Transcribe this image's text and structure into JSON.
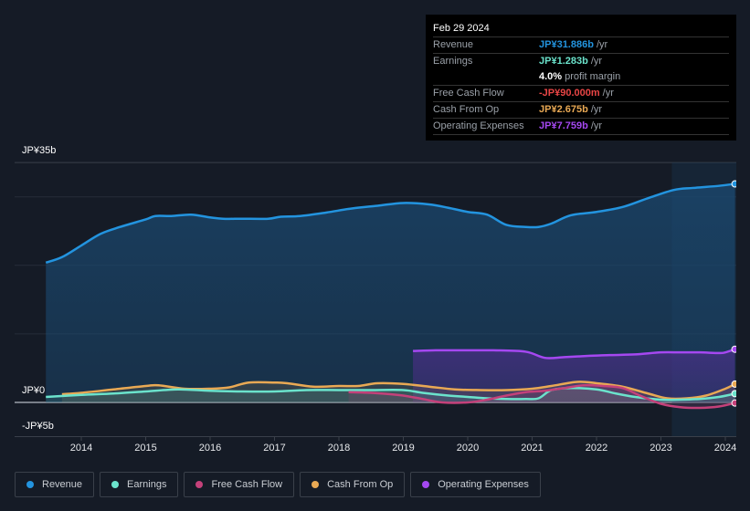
{
  "tooltip": {
    "date": "Feb 29 2024",
    "rows": [
      {
        "label": "Revenue",
        "value": "JP¥31.886b",
        "unit": "/yr",
        "color": "#2394df"
      },
      {
        "label": "Earnings",
        "value": "JP¥1.283b",
        "unit": "/yr",
        "color": "#6be3cc"
      },
      {
        "label": "",
        "value": "4.0%",
        "unit": "profit margin",
        "color": "#ffffff"
      },
      {
        "label": "Free Cash Flow",
        "value": "-JP¥90.000m",
        "unit": "/yr",
        "color": "#e84545"
      },
      {
        "label": "Cash From Op",
        "value": "JP¥2.675b",
        "unit": "/yr",
        "color": "#e9a954"
      },
      {
        "label": "Operating Expenses",
        "value": "JP¥7.759b",
        "unit": "/yr",
        "color": "#a548f1"
      }
    ]
  },
  "legend": [
    {
      "label": "Revenue",
      "color": "#2394df"
    },
    {
      "label": "Earnings",
      "color": "#6be3cc"
    },
    {
      "label": "Free Cash Flow",
      "color": "#c4417a"
    },
    {
      "label": "Cash From Op",
      "color": "#e9a954"
    },
    {
      "label": "Operating Expenses",
      "color": "#a548f1"
    }
  ],
  "chart_data": {
    "type": "line",
    "title": "",
    "xlabel": "",
    "ylabel": "",
    "y_tick_labels": [
      "JP¥35b",
      "JP¥0",
      "-JP¥5b"
    ],
    "y_ticks": [
      35,
      0,
      -5
    ],
    "ylim": [
      -5,
      35
    ],
    "xlim": [
      2013.1,
      2024.2
    ],
    "x_tick_labels": [
      "2014",
      "2015",
      "2016",
      "2017",
      "2018",
      "2019",
      "2020",
      "2021",
      "2022",
      "2023",
      "2024"
    ],
    "x_ticks": [
      2014,
      2015,
      2016,
      2017,
      2018,
      2019,
      2020,
      2021,
      2022,
      2023,
      2024
    ],
    "grid": true,
    "highlight_start": 2023.17,
    "series": [
      {
        "name": "Revenue",
        "color": "#2394df",
        "fill": true,
        "x": [
          2013.45,
          2013.7,
          2014.0,
          2014.3,
          2014.6,
          2015.0,
          2015.15,
          2015.4,
          2015.7,
          2016.0,
          2016.2,
          2016.5,
          2016.9,
          2017.1,
          2017.4,
          2017.8,
          2018.2,
          2018.6,
          2019.0,
          2019.4,
          2019.7,
          2020.0,
          2020.3,
          2020.6,
          2020.9,
          2021.1,
          2021.3,
          2021.6,
          2022.0,
          2022.4,
          2022.8,
          2023.2,
          2023.5,
          2023.9,
          2024.15
        ],
        "y": [
          20.4,
          21.2,
          22.9,
          24.6,
          25.6,
          26.7,
          27.2,
          27.2,
          27.4,
          27.0,
          26.8,
          26.8,
          26.8,
          27.1,
          27.2,
          27.7,
          28.3,
          28.7,
          29.1,
          28.9,
          28.4,
          27.8,
          27.4,
          25.9,
          25.6,
          25.6,
          26.1,
          27.3,
          27.8,
          28.5,
          29.8,
          31.0,
          31.3,
          31.6,
          31.886
        ]
      },
      {
        "name": "Earnings",
        "color": "#6be3cc",
        "fill": true,
        "x": [
          2013.45,
          2014.0,
          2014.5,
          2015.0,
          2015.5,
          2016.0,
          2016.5,
          2017.0,
          2017.5,
          2018.0,
          2018.5,
          2019.0,
          2019.3,
          2019.7,
          2020.0,
          2020.3,
          2020.6,
          2020.9,
          2021.1,
          2021.3,
          2021.6,
          2022.0,
          2022.3,
          2022.6,
          2023.0,
          2023.3,
          2023.6,
          2023.9,
          2024.15
        ],
        "y": [
          0.8,
          1.1,
          1.3,
          1.6,
          1.9,
          1.7,
          1.6,
          1.6,
          1.8,
          1.8,
          1.8,
          1.8,
          1.4,
          1.0,
          0.8,
          0.6,
          0.5,
          0.5,
          0.6,
          1.8,
          2.1,
          1.9,
          1.3,
          0.8,
          0.4,
          0.4,
          0.5,
          0.8,
          1.283
        ]
      },
      {
        "name": "Free Cash Flow",
        "color": "#c4417a",
        "fill": true,
        "x": [
          2018.15,
          2018.5,
          2018.8,
          2019.0,
          2019.3,
          2019.6,
          2020.0,
          2020.3,
          2020.6,
          2020.9,
          2021.2,
          2021.5,
          2021.8,
          2022.1,
          2022.4,
          2022.7,
          2023.0,
          2023.3,
          2023.6,
          2023.9,
          2024.15
        ],
        "y": [
          1.5,
          1.4,
          1.2,
          1.0,
          0.5,
          0.0,
          0.0,
          0.4,
          1.0,
          1.5,
          1.7,
          2.1,
          2.5,
          2.4,
          2.1,
          0.9,
          -0.2,
          -0.7,
          -0.8,
          -0.6,
          -0.09
        ]
      },
      {
        "name": "Cash From Op",
        "color": "#e9a954",
        "fill": true,
        "x": [
          2013.7,
          2014.0,
          2014.5,
          2015.0,
          2015.2,
          2015.6,
          2016.0,
          2016.3,
          2016.6,
          2017.0,
          2017.2,
          2017.6,
          2018.0,
          2018.3,
          2018.6,
          2019.0,
          2019.4,
          2019.8,
          2020.2,
          2020.6,
          2021.0,
          2021.3,
          2021.7,
          2022.0,
          2022.4,
          2022.8,
          2023.1,
          2023.4,
          2023.7,
          2024.0,
          2024.15
        ],
        "y": [
          1.2,
          1.4,
          1.9,
          2.4,
          2.5,
          2.0,
          2.0,
          2.2,
          2.9,
          2.9,
          2.8,
          2.3,
          2.4,
          2.4,
          2.8,
          2.7,
          2.3,
          1.9,
          1.8,
          1.8,
          2.0,
          2.4,
          3.0,
          2.8,
          2.3,
          1.3,
          0.6,
          0.6,
          1.0,
          2.0,
          2.675
        ]
      },
      {
        "name": "Operating Expenses",
        "color": "#a548f1",
        "fill": true,
        "x": [
          2019.15,
          2019.5,
          2019.8,
          2020.1,
          2020.4,
          2020.9,
          2021.2,
          2021.5,
          2021.9,
          2022.2,
          2022.6,
          2023.0,
          2023.3,
          2023.6,
          2023.9,
          2024.0,
          2024.15
        ],
        "y": [
          7.5,
          7.6,
          7.6,
          7.6,
          7.6,
          7.4,
          6.5,
          6.6,
          6.8,
          6.9,
          7.0,
          7.3,
          7.3,
          7.3,
          7.2,
          7.3,
          7.759
        ]
      }
    ]
  }
}
